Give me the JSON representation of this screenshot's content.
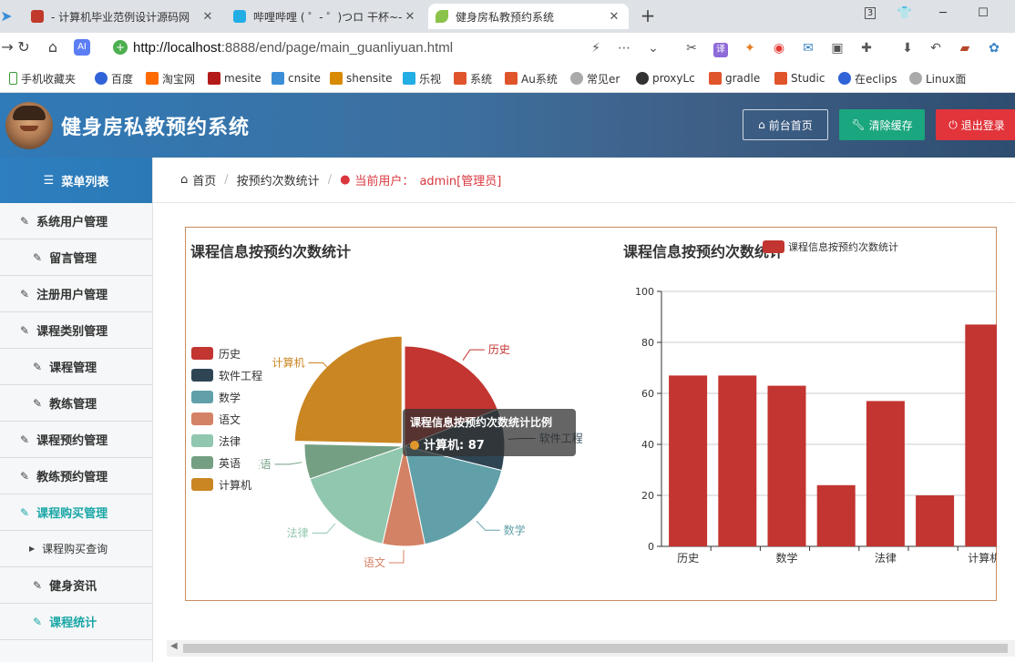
{
  "browser": {
    "tabs": [
      {
        "title": "- 计算机毕业范例设计源码网",
        "color": "#c0392b"
      },
      {
        "title": "哔哩哔哩 ( ゜- ゜)つロ 干杯~-b",
        "color": "#23ade5"
      },
      {
        "title": "健身房私教预约系统",
        "color": "#8bc34a"
      }
    ],
    "tab_count_badge": "3",
    "url_host": "http://localhost",
    "url_rest": ":8888/end/page/main_guanliyuan.html",
    "bookmarks": [
      "手机收藏夹",
      "百度",
      "淘宝网",
      "mesite",
      "cnsite",
      "shensite",
      "乐视",
      "系统",
      "Au系统",
      "常见er",
      "proxyLc",
      "gradle",
      "Studic",
      "在eclips",
      "Linux面"
    ]
  },
  "header": {
    "title": "健身房私教预约系统",
    "home_btn": "前台首页",
    "clear_btn": "清除缓存",
    "logout_btn": "退出登录"
  },
  "sidebar": {
    "title": "菜单列表",
    "items": [
      {
        "label": "系统用户管理",
        "indent": false
      },
      {
        "label": "留言管理",
        "indent": true
      },
      {
        "label": "注册用户管理",
        "indent": false
      },
      {
        "label": "课程类别管理",
        "indent": false
      },
      {
        "label": "课程管理",
        "indent": true
      },
      {
        "label": "教练管理",
        "indent": true
      },
      {
        "label": "课程预约管理",
        "indent": false
      },
      {
        "label": "教练预约管理",
        "indent": false
      },
      {
        "label": "课程购买管理",
        "indent": false
      },
      {
        "label": "课程购买查询",
        "indent": false
      },
      {
        "label": "健身资讯",
        "indent": true
      },
      {
        "label": "课程统计",
        "indent": true
      }
    ]
  },
  "breadcrumb": {
    "home": "首页",
    "current": "按预约次数统计",
    "user_label": "当前用户：",
    "user_value": "admin[管理员]"
  },
  "colors": {
    "pie": [
      "#c23531",
      "#2f4554",
      "#61a0a8",
      "#d48265",
      "#91c7ae",
      "#749f83",
      "#ca8622"
    ],
    "bar": "#c23531"
  },
  "chart_data": [
    {
      "type": "pie",
      "title": "课程信息按预约次数统计",
      "legend": [
        "历史",
        "软件工程",
        "数学",
        "语文",
        "法律",
        "英语",
        "计算机"
      ],
      "categories": [
        "历史",
        "软件工程",
        "数学",
        "语文",
        "法律",
        "英语",
        "计算机"
      ],
      "values": [
        67,
        35,
        63,
        24,
        57,
        20,
        87
      ],
      "legend_position": "left",
      "tooltip": {
        "title": "课程信息按预约次数统计比例",
        "label": "计算机",
        "value": "87"
      }
    },
    {
      "type": "bar",
      "title": "课程信息按预约次数统计",
      "legend": [
        "课程信息按预约次数统计"
      ],
      "categories": [
        "历史",
        "软件工程",
        "数学",
        "语文",
        "法律",
        "英语",
        "计算机"
      ],
      "values": [
        67,
        67,
        63,
        24,
        57,
        20,
        87
      ],
      "x_tick_labels": [
        "历史",
        "数学",
        "法律",
        "计算机"
      ],
      "y_ticks": [
        "0",
        "20",
        "40",
        "60",
        "80",
        "100"
      ],
      "ylim": [
        0,
        100
      ],
      "grid": true
    }
  ]
}
